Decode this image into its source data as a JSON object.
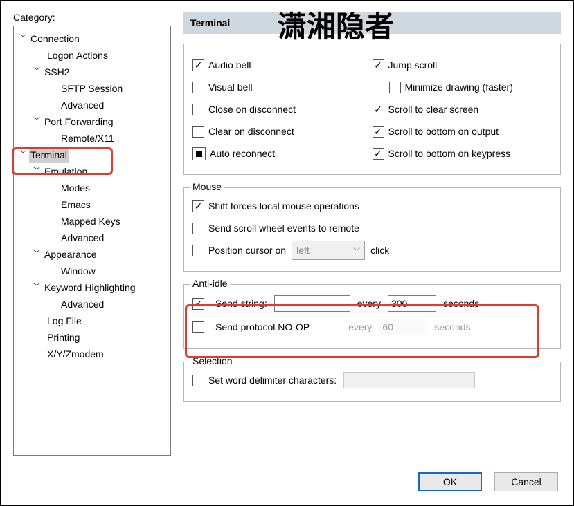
{
  "watermark": "潇湘隐者",
  "sidebar_label": "Category:",
  "tree": {
    "connection": "Connection",
    "logon_actions": "Logon Actions",
    "ssh2": "SSH2",
    "sftp_session": "SFTP Session",
    "advanced1": "Advanced",
    "port_forwarding": "Port Forwarding",
    "remote_x11": "Remote/X11",
    "terminal": "Terminal",
    "emulation": "Emulation",
    "modes": "Modes",
    "emacs": "Emacs",
    "mapped_keys": "Mapped Keys",
    "advanced2": "Advanced",
    "appearance": "Appearance",
    "window": "Window",
    "keyword_highlighting": "Keyword Highlighting",
    "advanced3": "Advanced",
    "log_file": "Log File",
    "printing": "Printing",
    "xyz": "X/Y/Zmodem"
  },
  "header": "Terminal",
  "opts": {
    "audio_bell": "Audio bell",
    "visual_bell": "Visual bell",
    "close_on_disconnect": "Close on disconnect",
    "clear_on_disconnect": "Clear on disconnect",
    "auto_reconnect": "Auto reconnect",
    "jump_scroll": "Jump scroll",
    "minimize_drawing": "Minimize drawing (faster)",
    "scroll_clear": "Scroll to clear screen",
    "scroll_bottom_output": "Scroll to bottom on output",
    "scroll_bottom_keypress": "Scroll to bottom on keypress"
  },
  "mouse": {
    "title": "Mouse",
    "shift_local": "Shift forces local mouse operations",
    "send_wheel": "Send scroll wheel events to remote",
    "position_cursor": "Position cursor on",
    "combo_value": "left",
    "click_suffix": "click"
  },
  "anti_idle": {
    "title": "Anti-idle",
    "send_string": "Send string:",
    "send_string_value": "",
    "every": "every",
    "interval1": "300",
    "seconds": "seconds",
    "send_noop": "Send protocol NO-OP",
    "interval2": "60"
  },
  "selection": {
    "title": "Selection",
    "set_delim": "Set word delimiter characters:",
    "delim_value": ""
  },
  "buttons": {
    "ok": "OK",
    "cancel": "Cancel"
  }
}
